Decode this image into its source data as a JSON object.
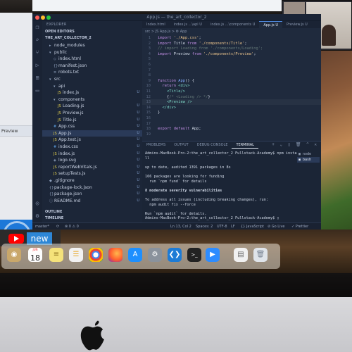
{
  "window": {
    "title": "App.js — the_art_collector_2"
  },
  "explorer": {
    "header": "EXPLORER",
    "open_editors": "OPEN EDITORS",
    "project": "THE_ART_COLLECTOR_2",
    "outline": "OUTLINE",
    "timeline": "TIMELINE",
    "files": [
      {
        "name": "node_modules",
        "indent": 1,
        "icon": "▸",
        "flag": ""
      },
      {
        "name": "public",
        "indent": 1,
        "icon": "▾",
        "flag": ""
      },
      {
        "name": "index.html",
        "indent": 2,
        "icon": "◇",
        "flag": ""
      },
      {
        "name": "manifest.json",
        "indent": 2,
        "icon": "{}",
        "flag": ""
      },
      {
        "name": "robots.txt",
        "indent": 2,
        "icon": "≡",
        "flag": ""
      },
      {
        "name": "src",
        "indent": 1,
        "icon": "▾",
        "flag": ""
      },
      {
        "name": "api",
        "indent": 2,
        "icon": "▾",
        "flag": ""
      },
      {
        "name": "index.js",
        "indent": 3,
        "icon": "JS",
        "flag": "U"
      },
      {
        "name": "components",
        "indent": 2,
        "icon": "▾",
        "flag": ""
      },
      {
        "name": "Loading.js",
        "indent": 3,
        "icon": "JS",
        "flag": "U"
      },
      {
        "name": "Preview.js",
        "indent": 3,
        "icon": "JS",
        "flag": "U"
      },
      {
        "name": "Title.js",
        "indent": 3,
        "icon": "JS",
        "flag": "U"
      },
      {
        "name": "App.css",
        "indent": 2,
        "icon": "#",
        "flag": "U"
      },
      {
        "name": "App.js",
        "indent": 2,
        "icon": "JS",
        "flag": "U",
        "active": true
      },
      {
        "name": "App.test.js",
        "indent": 2,
        "icon": "JS",
        "flag": "U"
      },
      {
        "name": "index.css",
        "indent": 2,
        "icon": "#",
        "flag": "U"
      },
      {
        "name": "index.js",
        "indent": 2,
        "icon": "JS",
        "flag": "U"
      },
      {
        "name": "logo.svg",
        "indent": 2,
        "icon": "◈",
        "flag": "U"
      },
      {
        "name": "reportWebVitals.js",
        "indent": 2,
        "icon": "JS",
        "flag": "U"
      },
      {
        "name": "setupTests.js",
        "indent": 2,
        "icon": "JS",
        "flag": "U"
      },
      {
        "name": ".gitignore",
        "indent": 1,
        "icon": "◆",
        "flag": "U"
      },
      {
        "name": "package-lock.json",
        "indent": 1,
        "icon": "{}",
        "flag": "U"
      },
      {
        "name": "package.json",
        "indent": 1,
        "icon": "{}",
        "flag": "U"
      },
      {
        "name": "README.md",
        "indent": 1,
        "icon": "ⓘ",
        "flag": "U"
      }
    ]
  },
  "tabs": [
    {
      "label": "Index.html",
      "active": false
    },
    {
      "label": "index.js ...\\api U",
      "active": false
    },
    {
      "label": "index.js ...\\components U",
      "active": false
    },
    {
      "label": "App.js  U",
      "active": true
    },
    {
      "label": "Preview.js  U",
      "active": false
    }
  ],
  "breadcrumb": "src > JS App.js > ⚙ App",
  "code_lines": [
    {
      "n": "1",
      "html": "<span class='kw'>import</span> <span class='str'>'./App.css'</span>;"
    },
    {
      "n": "2",
      "html": "<span class='kw'>import</span> Title <span class='kw'>from</span> <span class='str'>'./components/Title'</span>;"
    },
    {
      "n": "3",
      "html": "<span class='cm'>// import Loading from './components/Loading';</span>"
    },
    {
      "n": "4",
      "html": "<span class='kw'>import</span> Preview <span class='kw'>from</span> <span class='str'>'./components/Preview'</span>;"
    },
    {
      "n": "5",
      "html": ""
    },
    {
      "n": "6",
      "html": ""
    },
    {
      "n": "7",
      "html": ""
    },
    {
      "n": "8",
      "html": ""
    },
    {
      "n": "9",
      "html": "<span class='kw'>function</span> <span class='fn'>App</span>() {"
    },
    {
      "n": "10",
      "html": "  <span class='kw'>return</span> <span class='tag'>&lt;div&gt;</span>"
    },
    {
      "n": "11",
      "html": "    <span class='tag'>&lt;Title/&gt;</span>"
    },
    {
      "n": "12",
      "html": "    {<span class='cm'>/* &lt;Loading /&gt; */</span>}"
    },
    {
      "n": "13",
      "html": "    <span class='tag'>&lt;Preview /&gt;</span>"
    },
    {
      "n": "14",
      "html": "  <span class='tag'>&lt;/div&gt;</span>"
    },
    {
      "n": "15",
      "html": "}"
    },
    {
      "n": "16",
      "html": ""
    },
    {
      "n": "17",
      "html": ""
    },
    {
      "n": "18",
      "html": "<span class='kw'>export default</span> App;"
    },
    {
      "n": "19",
      "html": ""
    }
  ],
  "panel": {
    "tabs": [
      {
        "label": "PROBLEMS",
        "active": false
      },
      {
        "label": "OUTPUT",
        "active": false
      },
      {
        "label": "DEBUG CONSOLE",
        "active": false
      },
      {
        "label": "TERMINAL",
        "active": true
      }
    ],
    "actions": "+ ⌄ ▯ 🗑 ^ ✕",
    "terminals": [
      {
        "label": "node",
        "active": false
      },
      {
        "label": "bash",
        "active": true
      }
    ],
    "lines": [
      {
        "text": "Admins-MacBook-Pro-2:the_art_collector_2 Fullstack-Academy$ npm insta",
        "bold": false
      },
      {
        "text": "ll",
        "bold": false
      },
      {
        "text": "",
        "bold": false
      },
      {
        "text": "up to date, audited 1391 packages in 8s",
        "bold": false
      },
      {
        "text": "",
        "bold": false
      },
      {
        "text": "166 packages are looking for funding",
        "bold": false
      },
      {
        "text": "  run `npm fund` for details",
        "bold": false
      },
      {
        "text": "",
        "bold": false
      },
      {
        "text": "8 moderate severity vulnerabilities",
        "bold": true
      },
      {
        "text": "",
        "bold": false
      },
      {
        "text": "To address all issues (including breaking changes), run:",
        "bold": false
      },
      {
        "text": "  npm audit fix --force",
        "bold": false
      },
      {
        "text": "",
        "bold": false
      },
      {
        "text": "Run `npm audit` for details.",
        "bold": false
      },
      {
        "text": "Admins-MacBook-Pro-2:the_art_collector_2 Fullstack-Academy$ ▯",
        "bold": false
      }
    ]
  },
  "statusbar": {
    "branch": "master*",
    "sync": "⟳",
    "problems": "⊗ 0 ⚠ 0",
    "position": "Ln 13, Col 2",
    "spaces": "Spaces: 2",
    "encoding": "UTF-8",
    "eol": "LF",
    "language": "{} JavaScript",
    "golive": "⊘ Go Live",
    "prettier": "✓ Prettier"
  },
  "outer_statusbar": {
    "language": "JavaScript",
    "prettier": "✓ Prettier"
  },
  "browser_strip": "Preview",
  "youtube_new": "new",
  "dock": {
    "calendar_month": "JUN",
    "calendar_day": "18"
  }
}
